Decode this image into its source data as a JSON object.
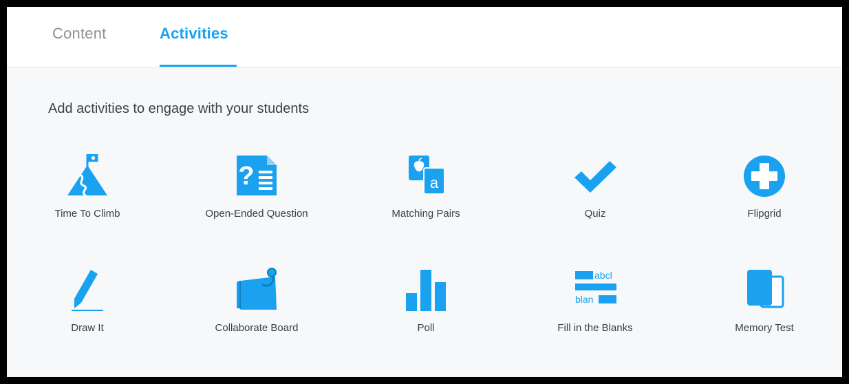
{
  "tabs": {
    "content_label": "Content",
    "activities_label": "Activities"
  },
  "accent_color": "#1aa1ef",
  "heading": "Add activities to engage with your students",
  "activities": [
    {
      "label": "Time To Climb",
      "icon": "mountain-flag-icon"
    },
    {
      "label": "Open-Ended Question",
      "icon": "question-document-icon"
    },
    {
      "label": "Matching Pairs",
      "icon": "matching-cards-icon"
    },
    {
      "label": "Quiz",
      "icon": "checkmark-icon"
    },
    {
      "label": "Flipgrid",
      "icon": "plus-circle-icon"
    },
    {
      "label": "Draw It",
      "icon": "pencil-icon"
    },
    {
      "label": "Collaborate Board",
      "icon": "pinned-note-icon"
    },
    {
      "label": "Poll",
      "icon": "bar-chart-icon"
    },
    {
      "label": "Fill in the Blanks",
      "icon": "fill-blanks-icon"
    },
    {
      "label": "Memory Test",
      "icon": "memory-cards-icon"
    }
  ],
  "icon_text": {
    "matching_letter": "a",
    "fill_word_1": "abcl",
    "fill_word_2": "blan"
  }
}
